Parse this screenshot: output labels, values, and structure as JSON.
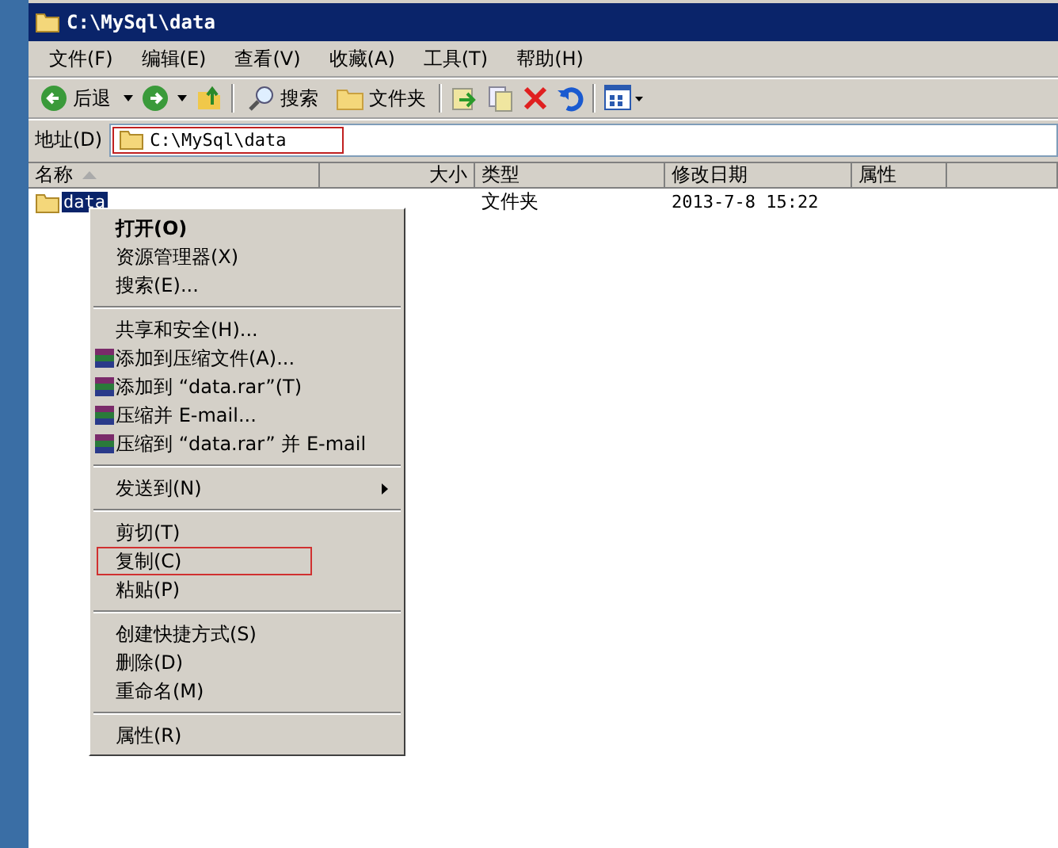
{
  "window": {
    "title": "C:\\MySql\\data"
  },
  "menu_bar": [
    "文件(F)",
    "编辑(E)",
    "查看(V)",
    "收藏(A)",
    "工具(T)",
    "帮助(H)"
  ],
  "toolbar": {
    "back": "后退",
    "search": "搜索",
    "folders": "文件夹"
  },
  "address": {
    "label": "地址(D)",
    "value": "C:\\MySql\\data",
    "highlighted": true
  },
  "table": {
    "columns": [
      {
        "label": "名称",
        "sorted": true
      },
      {
        "label": "大小",
        "sorted": false
      },
      {
        "label": "类型",
        "sorted": false
      },
      {
        "label": "修改日期",
        "sorted": false
      },
      {
        "label": "属性",
        "sorted": false
      }
    ],
    "rows": [
      {
        "name": "data",
        "size": "",
        "type": "文件夹",
        "modified": "2013-7-8 15:22",
        "selected": true
      }
    ]
  },
  "context_menu": [
    {
      "kind": "item",
      "label": "打开(O)",
      "default": true
    },
    {
      "kind": "item",
      "label": "资源管理器(X)"
    },
    {
      "kind": "item",
      "label": "搜索(E)..."
    },
    {
      "kind": "separator"
    },
    {
      "kind": "item",
      "label": "共享和安全(H)..."
    },
    {
      "kind": "rar",
      "label": "添加到压缩文件(A)..."
    },
    {
      "kind": "rar",
      "label": "添加到 “data.rar”(T)"
    },
    {
      "kind": "rar",
      "label": "压缩并 E-mail..."
    },
    {
      "kind": "rar",
      "label": "压缩到 “data.rar” 并 E-mail"
    },
    {
      "kind": "separator"
    },
    {
      "kind": "submenu",
      "label": "发送到(N)"
    },
    {
      "kind": "separator"
    },
    {
      "kind": "item",
      "label": "剪切(T)"
    },
    {
      "kind": "item",
      "label": "复制(C)",
      "highlighted": true
    },
    {
      "kind": "item",
      "label": "粘贴(P)"
    },
    {
      "kind": "separator"
    },
    {
      "kind": "item",
      "label": "创建快捷方式(S)"
    },
    {
      "kind": "item",
      "label": "删除(D)"
    },
    {
      "kind": "item",
      "label": "重命名(M)"
    },
    {
      "kind": "separator"
    },
    {
      "kind": "item",
      "label": "属性(R)"
    }
  ]
}
